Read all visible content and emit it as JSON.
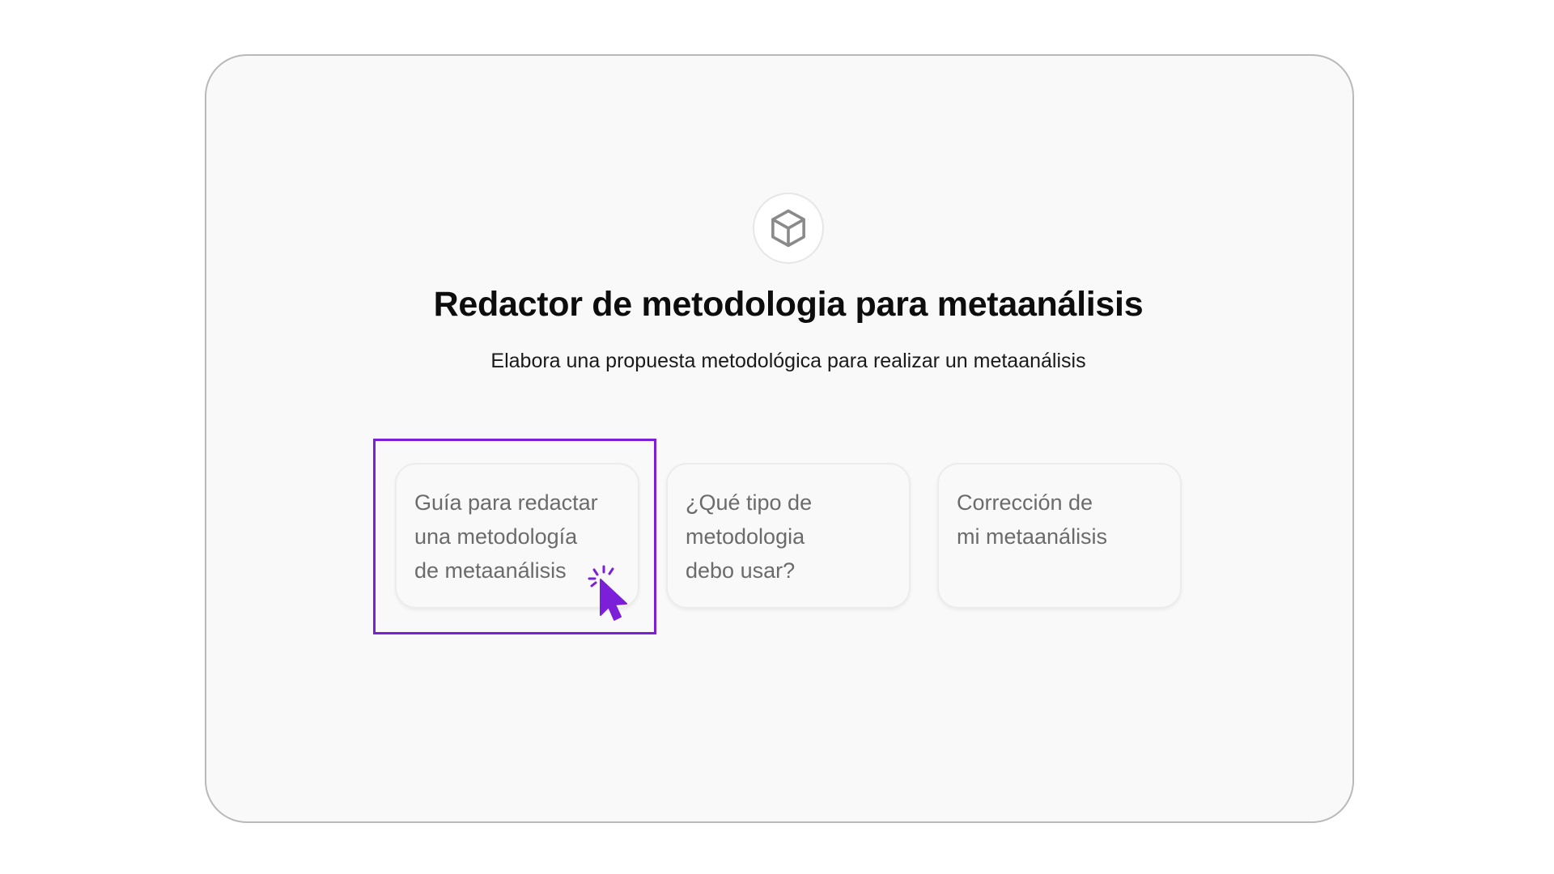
{
  "app": {
    "title": "Redactor de metodologia para metaanálisis",
    "subtitle": "Elabora una propuesta metodológica para realizar un metaanálisis",
    "logo_icon": "cube-icon"
  },
  "suggestions": [
    {
      "lines": [
        "Guía para redactar",
        "una metodología",
        "de metaanálisis"
      ]
    },
    {
      "lines": [
        "¿Qué tipo de",
        "metodologia",
        "debo usar?"
      ]
    },
    {
      "lines": [
        "Corrección de",
        "mi metaanálisis"
      ]
    }
  ],
  "overlay": {
    "highlight_color": "#7b1fd9",
    "cursor_icon": "click-cursor-icon"
  }
}
